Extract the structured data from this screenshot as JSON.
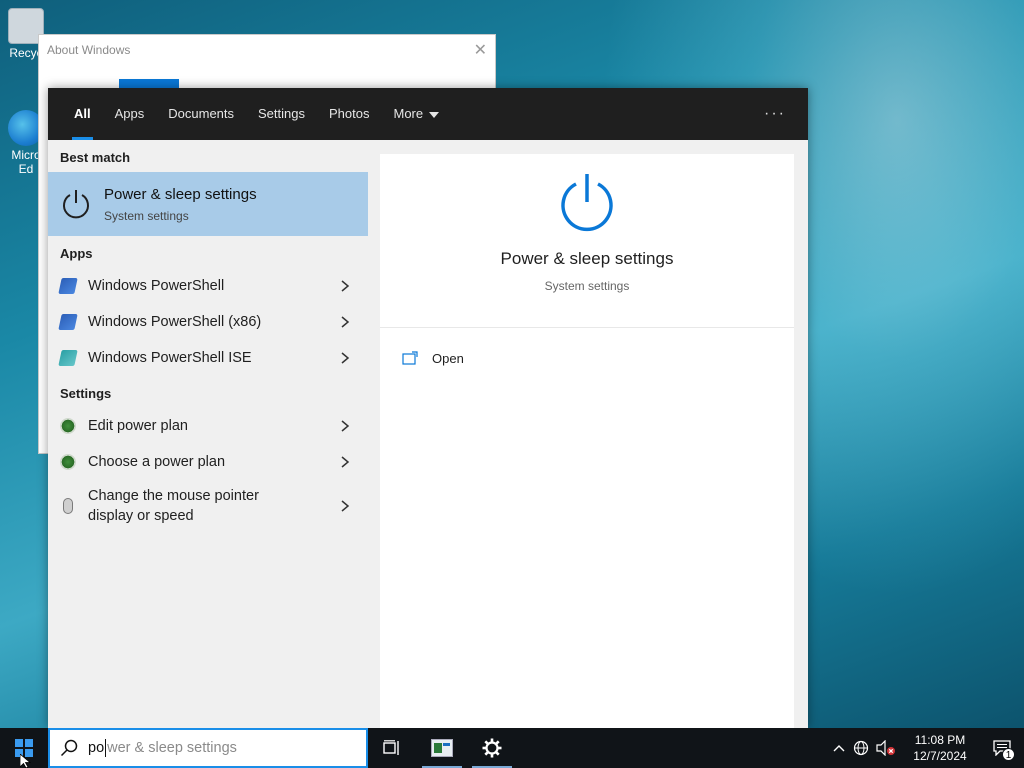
{
  "desktop": {
    "icons": [
      {
        "label": "Recyc",
        "icon": "recycle-bin-icon"
      },
      {
        "label": "Micro Ed",
        "icon": "edge-icon"
      }
    ]
  },
  "about_window": {
    "title": "About Windows",
    "close_symbol": "✕"
  },
  "search_panel": {
    "tabs": [
      {
        "label": "All",
        "active": true
      },
      {
        "label": "Apps"
      },
      {
        "label": "Documents"
      },
      {
        "label": "Settings"
      },
      {
        "label": "Photos"
      },
      {
        "label": "More"
      }
    ],
    "overflow_symbol": "···",
    "best_match": {
      "header": "Best match",
      "title": "Power & sleep settings",
      "subtitle": "System settings"
    },
    "apps_section": {
      "header": "Apps",
      "items": [
        {
          "label": "Windows PowerShell"
        },
        {
          "label": "Windows PowerShell (x86)"
        },
        {
          "label": "Windows PowerShell ISE"
        }
      ]
    },
    "settings_section": {
      "header": "Settings",
      "items": [
        {
          "label": "Edit power plan"
        },
        {
          "label": "Choose a power plan"
        },
        {
          "label": "Change the mouse pointer display or speed"
        }
      ]
    },
    "preview": {
      "title": "Power & sleep settings",
      "subtitle": "System settings",
      "actions": [
        {
          "label": "Open"
        }
      ]
    }
  },
  "taskbar": {
    "search_typed": "po",
    "search_suggestion": "wer & sleep settings",
    "clock_time": "11:08 PM",
    "clock_date": "12/7/2024",
    "notification_count": "1"
  },
  "colors": {
    "accent": "#1a8ee8",
    "best_match_bg": "#a8cbe8",
    "tab_bar_bg": "#1f1f1f",
    "taskbar_bg": "#101418"
  }
}
